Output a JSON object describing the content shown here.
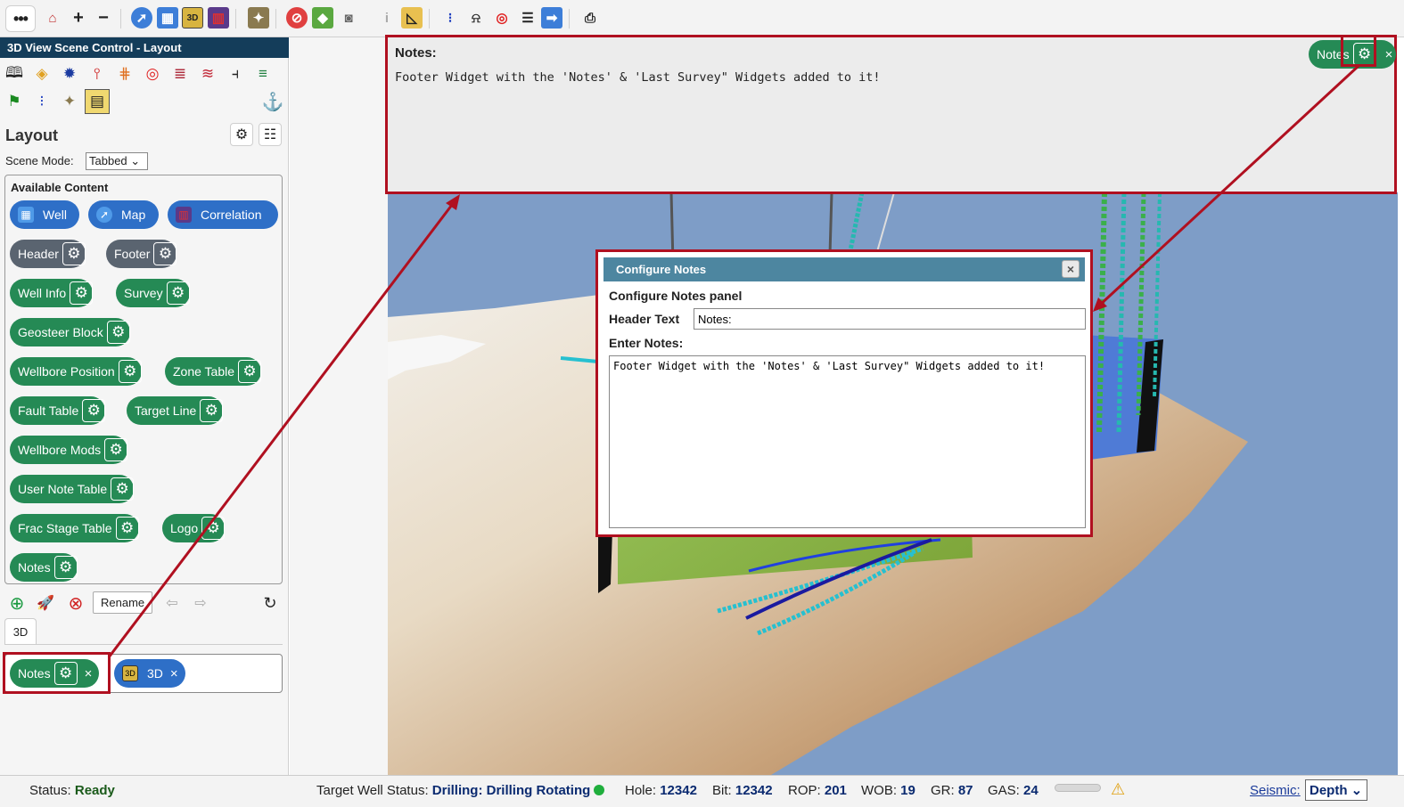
{
  "toolbar": {
    "menu_glyph": "•••",
    "icons": [
      "home-icon",
      "zoom-in-icon",
      "zoom-out-icon",
      "compass-map-icon",
      "well-grid-icon",
      "3d-view-icon",
      "correlation-icon",
      "geosteer-icon",
      "stop-icon",
      "cube-icon",
      "camera-icon",
      "info-icon",
      "ruler-icon",
      "survey-points-icon",
      "alarm-icon",
      "target-icon",
      "list-icon",
      "arrow-right-icon",
      "print-icon"
    ]
  },
  "left": {
    "panel_title": "3D View Scene Control - Layout",
    "layout_title": "Layout",
    "scene_mode_label": "Scene Mode:",
    "scene_mode_value": "Tabbed",
    "available_label": "Available Content",
    "pills": {
      "well": "Well",
      "map": "Map",
      "correlation": "Correlation",
      "header": "Header",
      "footer": "Footer",
      "well_info": "Well Info",
      "survey": "Survey",
      "geosteer_block": "Geosteer Block",
      "wellbore_position": "Wellbore Position",
      "zone_table": "Zone Table",
      "fault_table": "Fault Table",
      "target_line": "Target Line",
      "wellbore_mods": "Wellbore Mods",
      "user_note_table": "User Note Table",
      "frac_stage_table": "Frac Stage Table",
      "logo": "Logo",
      "notes": "Notes"
    },
    "rename_label": "Rename",
    "tab_label": "3D",
    "drop_notes": "Notes",
    "drop_3d": "3D",
    "close_glyph": "×",
    "three_d_glyph": "3D"
  },
  "notes_widget": {
    "header": "Notes:",
    "text": "Footer Widget with the 'Notes' & 'Last Survey\" Widgets added to it!",
    "pill_label": "Notes",
    "close_glyph": "×"
  },
  "dialog": {
    "title": "Configure Notes",
    "close_glyph": "×",
    "subtitle": "Configure Notes panel",
    "header_text_label": "Header Text",
    "header_text_value": "Notes:",
    "enter_notes_label": "Enter Notes:",
    "notes_value": "Footer Widget with the 'Notes' & 'Last Survey\" Widgets added to it!"
  },
  "status": {
    "status_label": "Status:",
    "status_value": "Ready",
    "target_label": "Target Well Status:",
    "target_value": "Drilling: Drilling Rotating",
    "hole_label": "Hole:",
    "hole_value": "12342",
    "bit_label": "Bit:",
    "bit_value": "12342",
    "rop_label": "ROP:",
    "rop_value": "201",
    "wob_label": "WOB:",
    "wob_value": "19",
    "gr_label": "GR:",
    "gr_value": "87",
    "gas_label": "GAS:",
    "gas_value": "24",
    "seismic_label": "Seismic:",
    "seismic_value": "Depth"
  },
  "colors": {
    "title_bar": "#143d5a",
    "pill_blue": "#2e6fc7",
    "pill_gray": "#5a6470",
    "pill_green": "#258a55",
    "highlight": "#b01020",
    "dialog_title": "#4d86a0",
    "scene_bg": "#7e9dc7"
  }
}
